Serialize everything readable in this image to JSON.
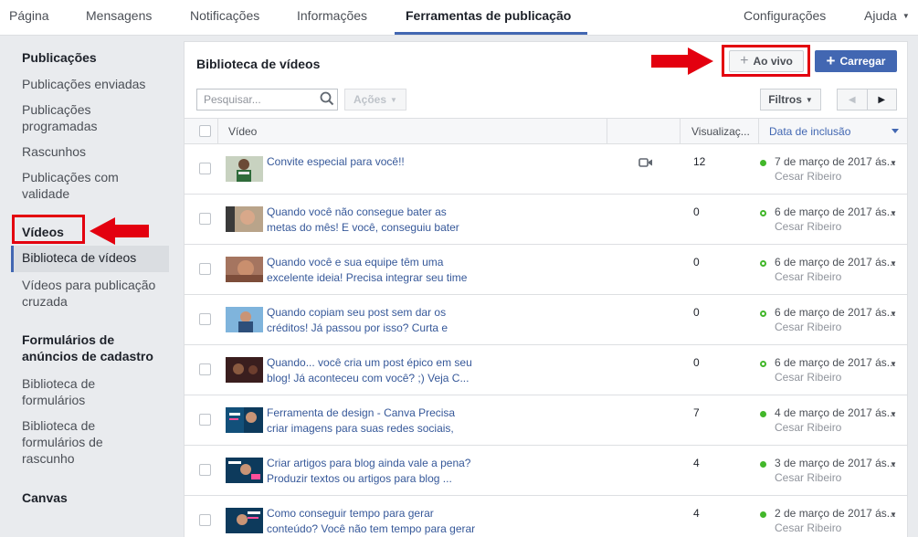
{
  "top_nav": {
    "items": [
      {
        "label": "Página"
      },
      {
        "label": "Mensagens"
      },
      {
        "label": "Notificações"
      },
      {
        "label": "Informações"
      },
      {
        "label": "Ferramentas de publicação"
      }
    ],
    "active_label": "Ferramentas de publicação",
    "settings_label": "Configurações",
    "help_label": "Ajuda"
  },
  "sidebar": {
    "sections": [
      {
        "heading": "Publicações",
        "items": [
          "Publicações enviadas",
          "Publicações programadas",
          "Rascunhos",
          "Publicações com validade"
        ]
      },
      {
        "heading": "Vídeos",
        "items": [
          "Biblioteca de vídeos",
          "Vídeos para publicação cruzada"
        ]
      },
      {
        "heading": "Formulários de anúncios de cadastro",
        "items": [
          "Biblioteca de formulários",
          "Biblioteca de formulários de rascunho"
        ]
      },
      {
        "heading": "Canvas",
        "items": []
      }
    ],
    "active_item": "Biblioteca de vídeos"
  },
  "library": {
    "title": "Biblioteca de vídeos",
    "live_button": "Ao vivo",
    "upload_button": "Carregar",
    "search_placeholder": "Pesquisar...",
    "actions_button": "Ações",
    "filters_button": "Filtros",
    "columns": {
      "video": "Vídeo",
      "views": "Visualizaç...",
      "date": "Data de inclusão"
    }
  },
  "videos": [
    {
      "title": "Convite especial para você!!",
      "views": "12",
      "date": "7 de março de 2017 ás...",
      "author": "Cesar Ribeiro",
      "status": "published",
      "camera_icon": true
    },
    {
      "title": "Quando você não consegue bater as metas do mês! E você, conseguiu bater sua...",
      "views": "0",
      "date": "6 de março de 2017 ás...",
      "author": "Cesar Ribeiro",
      "status": "scheduled"
    },
    {
      "title": "Quando você e sua equipe têm uma excelente ideia! Precisa integrar seu time de...",
      "views": "0",
      "date": "6 de março de 2017 ás...",
      "author": "Cesar Ribeiro",
      "status": "scheduled"
    },
    {
      "title": "Quando copiam seu post sem dar os créditos! Já passou por isso? Curta e compa...",
      "views": "0",
      "date": "6 de março de 2017 ás...",
      "author": "Cesar Ribeiro",
      "status": "scheduled"
    },
    {
      "title": "Quando... você cria um post épico em seu blog! Já aconteceu com você? ;) Veja C...",
      "views": "0",
      "date": "6 de março de 2017 ás...",
      "author": "Cesar Ribeiro",
      "status": "scheduled"
    },
    {
      "title": "Ferramenta de design - Canva Precisa criar imagens para suas redes sociais, an...",
      "views": "7",
      "date": "4 de março de 2017 ás...",
      "author": "Cesar Ribeiro",
      "status": "published"
    },
    {
      "title": "Criar artigos para blog ainda vale a pena? Produzir textos ou artigos para blog ...",
      "views": "4",
      "date": "3 de março de 2017 ás...",
      "author": "Cesar Ribeiro",
      "status": "published"
    },
    {
      "title": "Como conseguir tempo para gerar conteúdo? Você não tem tempo para gerar con...",
      "views": "4",
      "date": "2 de março de 2017 ás...",
      "author": "Cesar Ribeiro",
      "status": "published"
    }
  ],
  "colors": {
    "accent": "#4267b2",
    "link": "#365899",
    "status_green": "#42b72a",
    "annotation_red": "#e3000f"
  },
  "icons": {
    "search": "search-icon",
    "camera": "video-camera-icon",
    "sort": "sort-desc-caret-icon",
    "prev": "chevron-left-icon",
    "next": "chevron-right-icon"
  }
}
